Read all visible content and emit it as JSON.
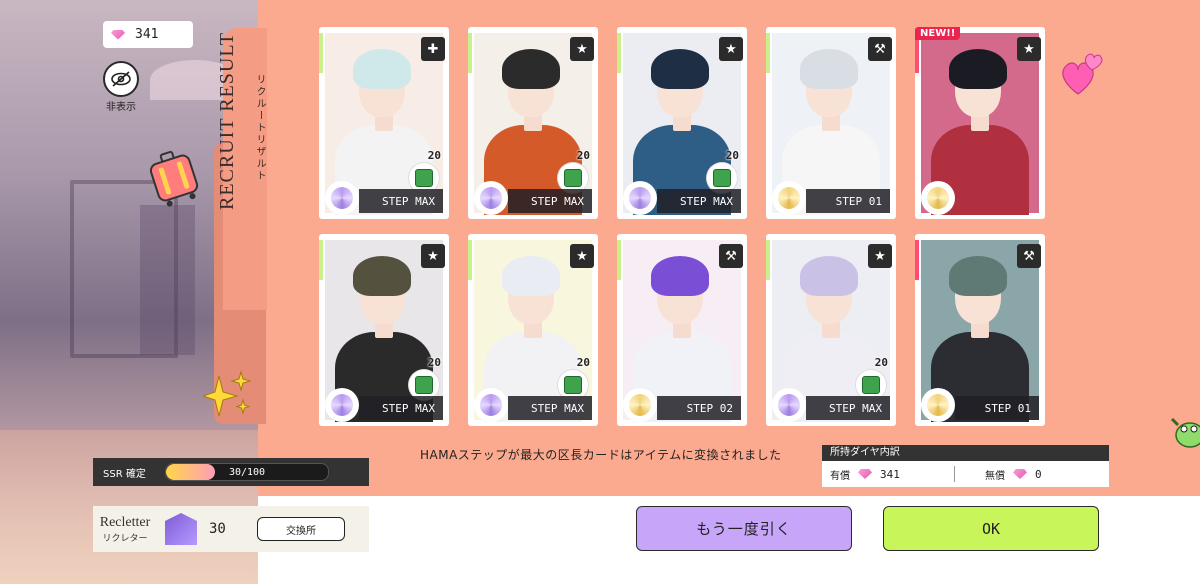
{
  "currency": {
    "diamonds": "341"
  },
  "hide": {
    "label": "非表示"
  },
  "side_tab": {
    "title_en": "RECRUIT RESULT",
    "title_jp": "リクルートリザルト"
  },
  "cards": [
    {
      "step": "STEP MAX",
      "count": "20",
      "type_icon": "kit-icon",
      "rarity": "silver",
      "new": false,
      "hair": "#cfe9ea",
      "outfit": "#f3f3f3",
      "bg": "#f8ece6",
      "stripe": "green"
    },
    {
      "step": "STEP MAX",
      "count": "20",
      "type_icon": "star-icon",
      "rarity": "silver",
      "new": false,
      "hair": "#2b2b2b",
      "outfit": "#d45a2a",
      "bg": "#f4efe8",
      "stripe": "green"
    },
    {
      "step": "STEP MAX",
      "count": "20",
      "type_icon": "star-icon",
      "rarity": "silver",
      "new": false,
      "hair": "#1e2f45",
      "outfit": "#2e5d86",
      "bg": "#ecedf2",
      "stripe": "green"
    },
    {
      "step": "STEP 01",
      "count": "",
      "type_icon": "drill-icon",
      "rarity": "gold",
      "new": false,
      "hair": "#d9dde4",
      "outfit": "#f6f6f6",
      "bg": "#eef1f6",
      "stripe": "green"
    },
    {
      "step": "",
      "count": "",
      "type_icon": "star-icon",
      "rarity": "gold",
      "new": true,
      "new_label": "NEW!!",
      "hair": "#1b1b24",
      "outfit": "#b0303f",
      "bg": "#d36a8c",
      "stripe": "pink"
    },
    {
      "step": "STEP MAX",
      "count": "20",
      "type_icon": "star-icon",
      "rarity": "silver",
      "new": false,
      "hair": "#54513f",
      "outfit": "#2a2a2a",
      "bg": "#e9e6ea",
      "stripe": "green"
    },
    {
      "step": "STEP MAX",
      "count": "20",
      "type_icon": "star-icon",
      "rarity": "silver",
      "new": false,
      "hair": "#e9ecf2",
      "outfit": "#f2f2f4",
      "bg": "#f8f6dc",
      "stripe": "green"
    },
    {
      "step": "STEP 02",
      "count": "",
      "type_icon": "drill-icon",
      "rarity": "gold",
      "new": false,
      "hair": "#7a4fd6",
      "outfit": "#f0f2f8",
      "bg": "#f6eef4",
      "stripe": "green"
    },
    {
      "step": "STEP MAX",
      "count": "20",
      "type_icon": "star-icon",
      "rarity": "silver",
      "new": false,
      "hair": "#c9c2e6",
      "outfit": "#eeeef4",
      "bg": "#eceef4",
      "stripe": "green"
    },
    {
      "step": "STEP 01",
      "count": "",
      "type_icon": "drill-icon",
      "rarity": "gold",
      "new": false,
      "hair": "#5f7a74",
      "outfit": "#2b2d33",
      "bg": "#8aa6a8",
      "stripe": "pink"
    }
  ],
  "notice": "HAMAステップが最大の区長カードはアイテムに変換されました",
  "wallet": {
    "title": "所持ダイヤ内訳",
    "paid_label": "有償",
    "paid_value": "341",
    "free_label": "無償",
    "free_value": "0"
  },
  "ssr": {
    "label": "SSR 確定",
    "progress_text": "30/100",
    "progress_fraction": 0.3
  },
  "recletter": {
    "name_en": "Recletter",
    "name_jp": "リクレター",
    "count": "30",
    "exchange_label": "交換所"
  },
  "buttons": {
    "again": "もう一度引く",
    "ok": "OK"
  },
  "colors": {
    "panel": "#fbaa90",
    "again_btn": "#c7a6fa",
    "ok_btn": "#c8f65a",
    "new_badge": "#e8244f"
  }
}
